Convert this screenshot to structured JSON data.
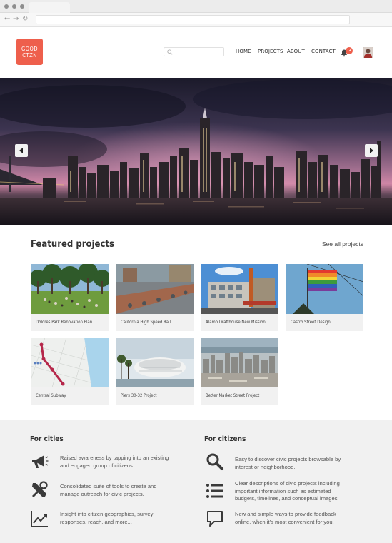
{
  "app": {
    "logo_line1": "GOOD",
    "logo_line2": "CTZN"
  },
  "browser": {
    "back_glyph": "←",
    "forward_glyph": "→",
    "reload_glyph": "↻"
  },
  "search": {
    "placeholder": ""
  },
  "nav": {
    "items": [
      {
        "label": "HOME"
      },
      {
        "label": "PROJECTS"
      },
      {
        "label": "ABOUT"
      },
      {
        "label": "CONTACT"
      }
    ],
    "notification_count": "1+"
  },
  "featured": {
    "title": "Featured projects",
    "see_all": "See all projects",
    "projects": [
      {
        "name": "Dolores Park Renovation Plan",
        "image": "park-photo"
      },
      {
        "name": "California High Speed Rail",
        "image": "rail-track-photo"
      },
      {
        "name": "Alamo Drafthouse New Mission",
        "image": "theater-building-photo"
      },
      {
        "name": "Castro Street Design",
        "image": "rainbow-flag-photo"
      },
      {
        "name": "Central Subway",
        "image": "subway-map"
      },
      {
        "name": "Piers 30-32 Project",
        "image": "arena-rendering"
      },
      {
        "name": "Better Market Street Project",
        "image": "city-aerial-photo"
      }
    ]
  },
  "cities": {
    "title": "For cities",
    "items": [
      {
        "icon": "megaphone-icon",
        "text_line1": "Raised awareness by tapping into an existing",
        "text_line2": "and engaged group of citizens."
      },
      {
        "icon": "tools-icon",
        "text_line1": "Consolidated suite of tools to create and",
        "text_line2": "manage outreach for civic projects."
      },
      {
        "icon": "chart-icon",
        "text_line1": "Insight into citizen geographics, survey",
        "text_line2": "responses, reach, and more..."
      }
    ]
  },
  "citizens": {
    "title": "For citizens",
    "items": [
      {
        "icon": "search-icon",
        "text_line1": "Easy to discover civic projects browsable by",
        "text_line2": "interest or neighborhood.",
        "text_line3": ""
      },
      {
        "icon": "list-icon",
        "text_line1": "Clear descriptions of civic projects including",
        "text_line2": "important information such as estimated",
        "text_line3": "budgets, timelines, and conceptual images."
      },
      {
        "icon": "speech-bubble-icon",
        "text_line1": "New and simple ways to provide feedback",
        "text_line2": "online, when it’s most convenient for you.",
        "text_line3": ""
      }
    ]
  },
  "colors": {
    "accent": "#ee5f4c",
    "footer_bg": "#f1f1f1",
    "icon": "#3a3a3a"
  }
}
